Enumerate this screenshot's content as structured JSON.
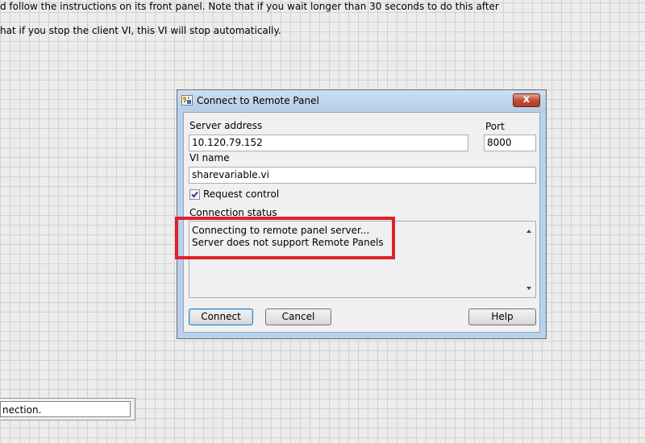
{
  "background": {
    "line1": "d follow the instructions on its front panel. Note that if you wait longer than 30 seconds to do this after",
    "line2": "hat if you stop the client VI, this VI will stop automatically.",
    "bottom_box_text": "nection."
  },
  "dialog": {
    "title": "Connect to Remote Panel",
    "close_glyph": "x",
    "server_address_label": "Server address",
    "server_address_value": "10.120.79.152",
    "port_label": "Port",
    "port_value": "8000",
    "vi_name_label": "VI name",
    "vi_name_value": "sharevariable.vi",
    "request_control_label": "Request control",
    "request_control_checked": true,
    "connection_status_label": "Connection status",
    "status_lines": [
      "Connecting to remote panel server...",
      "Server does not support Remote Panels"
    ],
    "buttons": {
      "connect": "Connect",
      "cancel": "Cancel",
      "help": "Help"
    }
  },
  "colors": {
    "highlight_box": "#e0202a",
    "close_button": "#c0503a"
  },
  "icons": [
    "app-icon",
    "close-icon",
    "checkbox-check-icon",
    "scroll-up-icon",
    "scroll-down-icon"
  ]
}
